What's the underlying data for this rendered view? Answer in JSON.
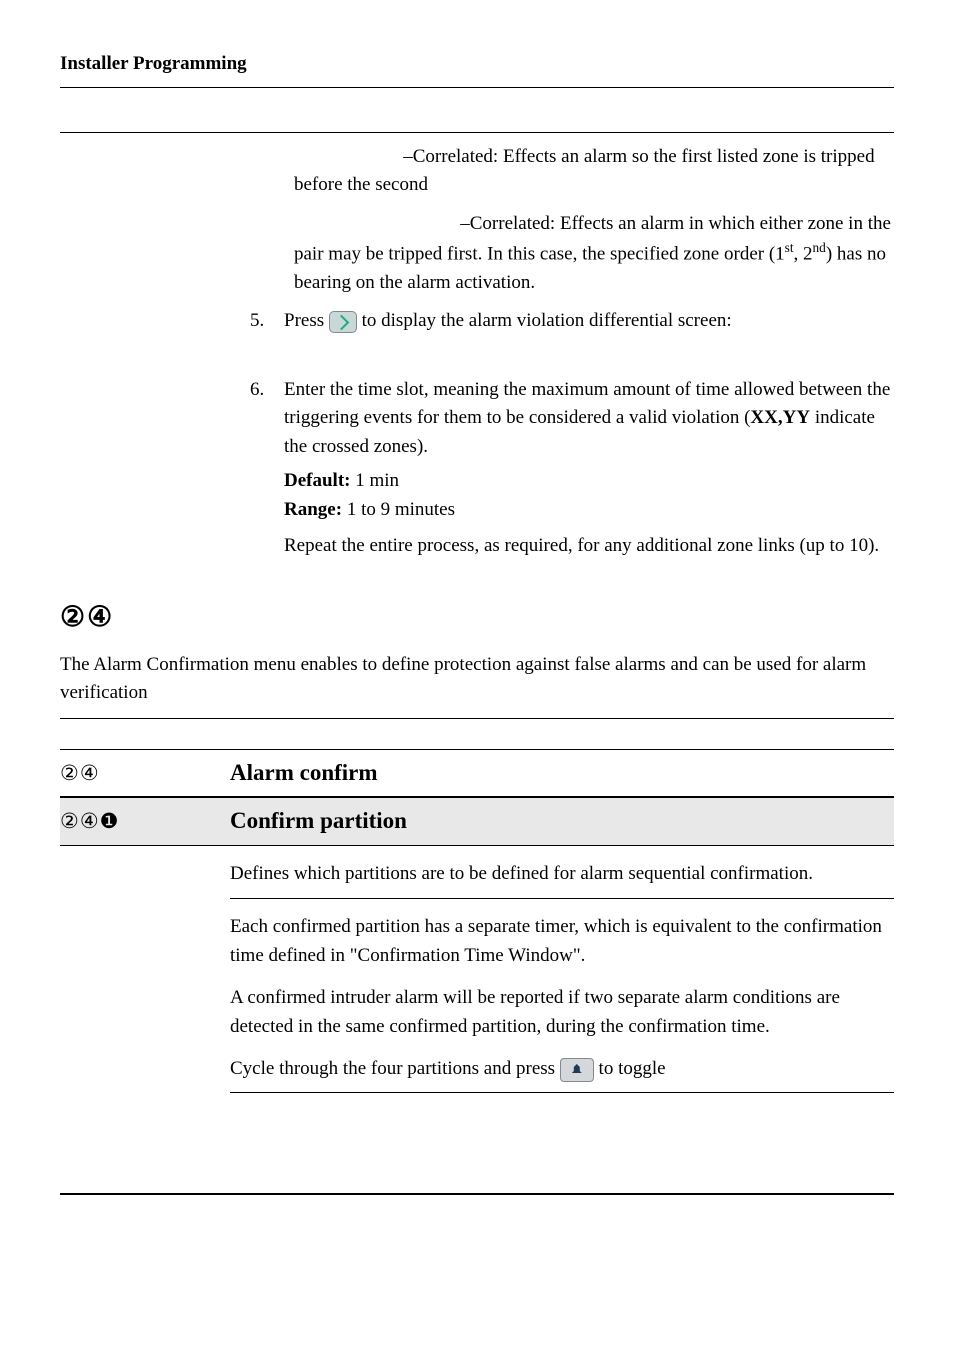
{
  "page_header": "Installer Programming",
  "block1": {
    "ordered_correlated": "–Correlated: Effects an alarm so the first listed zone is tripped before the second",
    "not_ordered_correlated_line1": "–Correlated: Effects an alarm in which either zone in the pair may be tripped first. In this case, the specified zone order (1",
    "sup1": "st",
    "mid": ", 2",
    "sup2": "nd",
    "not_ordered_correlated_line2": ") has no bearing on the alarm activation.",
    "step5_pre": "Press ",
    "step5_post": " to display the alarm violation differential screen:",
    "step6": "Enter the time slot, meaning the maximum amount of time allowed between the triggering events for them to be considered a valid violation (",
    "step6_bold": "XX,YY",
    "step6_end": " indicate the crossed zones).",
    "default_label": "Default:",
    "default_val": " 1 min",
    "range_label": "Range:",
    "range_val": " 1 to 9 minutes",
    "repeat": "Repeat the entire process, as required, for any additional zone links (up to 10)."
  },
  "section_header_circles": "②④",
  "section_desc": "The Alarm Confirmation menu enables to define protection against false alarms and can be used for alarm verification",
  "row1": {
    "label": "②④",
    "title": "Alarm confirm"
  },
  "row2": {
    "label": "②④❶",
    "title": "Confirm partition"
  },
  "body": {
    "p1": "Defines which partitions are to be defined for alarm sequential confirmation.",
    "p2": "Each confirmed partition has a separate timer, which is equivalent to the confirmation time defined in \"Confirmation Time Window\".",
    "p3": "A confirmed intruder alarm will be reported if two separate alarm conditions are detected in the same confirmed partition, during the confirmation time.",
    "p4_pre": "Cycle through the four partitions and press ",
    "p4_post": " to toggle"
  }
}
